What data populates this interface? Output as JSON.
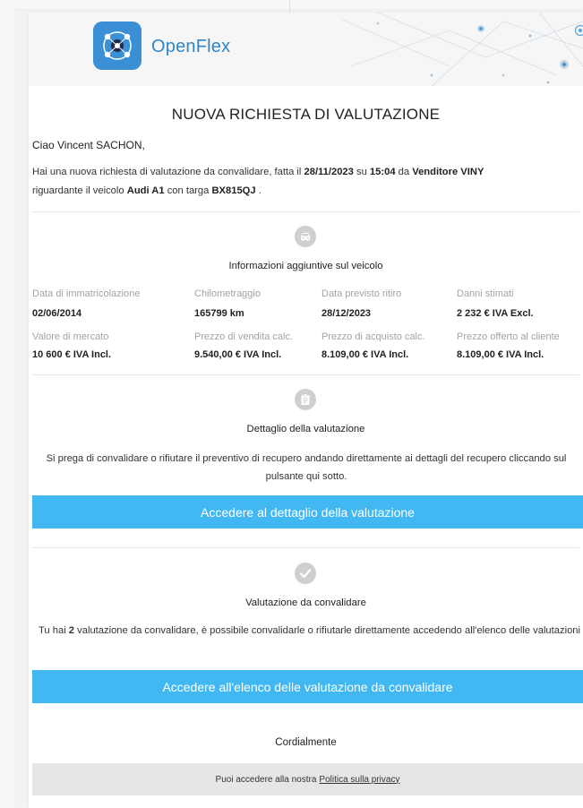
{
  "brand": {
    "name": "OpenFlex",
    "accent": "#42b8f2",
    "logo_color": "#3b8fd4"
  },
  "email": {
    "title": "NUOVA RICHIESTA DI VALUTAZIONE",
    "greeting": "Ciao Vincent SACHON,",
    "intro": {
      "p1": "Hai una nuova richiesta di valutazione da convalidare, fatta il",
      "date": "28/11/2023",
      "p2": "su",
      "time": "15:04",
      "p3": "da",
      "seller": "Venditore VINY",
      "p4": "riguardante il veicolo",
      "vehicle": "Audi A1",
      "p5": "con targa",
      "plate": "BX815QJ",
      "p6": "."
    },
    "vehicle_info": {
      "icon": "car-icon",
      "title": "Informazioni aggiuntive sul veicolo",
      "fields": [
        {
          "label": "Data di immatricolazione",
          "value": "02/06/2014"
        },
        {
          "label": "Chilometraggio",
          "value": "165799 km"
        },
        {
          "label": "Data previsto ritiro",
          "value": "28/12/2023"
        },
        {
          "label": "Danni stimati",
          "value": "2 232 € IVA Excl."
        },
        {
          "label": "Valore di mercato",
          "value": "10 600 € IVA Incl."
        },
        {
          "label": "Prezzo di vendita calc.",
          "value": "9.540,00 € IVA Incl."
        },
        {
          "label": "Prezzo di acquisto calc.",
          "value": "8.109,00 € IVA Incl."
        },
        {
          "label": "Prezzo offerto al cliente",
          "value": "8.109,00 € IVA Incl."
        }
      ]
    },
    "valuation_detail": {
      "icon": "clipboard-icon",
      "title": "Dettaglio della valutazione",
      "text": "Si prega di convalidare o rifiutare il preventivo di recupero andando direttamente ai dettagli del recupero cliccando sul pulsante qui sotto.",
      "button": "Accedere al dettaglio della valutazione"
    },
    "to_validate": {
      "icon": "checkmark-icon",
      "title": "Valutazione da convalidare",
      "text_pre": "Tu hai",
      "count": "2",
      "text_post": "valutazione da convalidare, è possibile convalidarle o rifiutarle direttamente accedendo all'elenco delle valutazioni",
      "button": "Accedere all'elenco delle valutazione da convalidare"
    },
    "closing": "Cordialmente",
    "footer": {
      "text": "Puoi accedere alla nostra",
      "link": "Politica sulla privacy"
    }
  }
}
